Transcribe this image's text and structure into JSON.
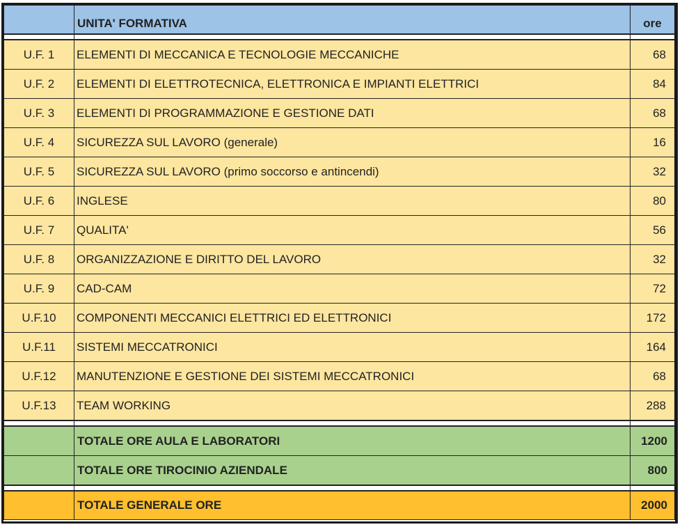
{
  "header": {
    "code": "",
    "unit_label": "UNITA' FORMATIVA",
    "hours_label": "ore"
  },
  "units": [
    {
      "code": "U.F. 1",
      "name": "ELEMENTI DI MECCANICA E TECNOLOGIE MECCANICHE",
      "hours": "68"
    },
    {
      "code": "U.F. 2",
      "name": "ELEMENTI DI ELETTROTECNICA,  ELETTRONICA E IMPIANTI ELETTRICI",
      "hours": "84"
    },
    {
      "code": "U.F. 3",
      "name": "ELEMENTI DI PROGRAMMAZIONE E GESTIONE DATI",
      "hours": "68"
    },
    {
      "code": "U.F. 4",
      "name": "SICUREZZA SUL LAVORO (generale)",
      "hours": "16"
    },
    {
      "code": "U.F. 5",
      "name": "SICUREZZA SUL LAVORO (primo soccorso e antincendi)",
      "hours": "32"
    },
    {
      "code": "U.F. 6",
      "name": "INGLESE",
      "hours": "80"
    },
    {
      "code": "U.F. 7",
      "name": "QUALITA'",
      "hours": "56"
    },
    {
      "code": "U.F. 8",
      "name": "ORGANIZZAZIONE E DIRITTO DEL LAVORO",
      "hours": "32"
    },
    {
      "code": "U.F. 9",
      "name": "CAD-CAM",
      "hours": "72"
    },
    {
      "code": "U.F.10",
      "name": "COMPONENTI MECCANICI ELETTRICI ED ELETTRONICI",
      "hours": "172"
    },
    {
      "code": "U.F.11",
      "name": "SISTEMI MECCATRONICI",
      "hours": "164"
    },
    {
      "code": "U.F.12",
      "name": "MANUTENZIONE E GESTIONE DEI SISTEMI MECCATRONICI",
      "hours": "68"
    },
    {
      "code": "U.F.13",
      "name": "TEAM WORKING",
      "hours": "288"
    }
  ],
  "totals": [
    {
      "label": "TOTALE ORE AULA E LABORATORI",
      "hours": "1200"
    },
    {
      "label": "TOTALE ORE TIROCINIO AZIENDALE",
      "hours": "800"
    }
  ],
  "grand_total": {
    "label": "TOTALE GENERALE ORE",
    "hours": "2000"
  },
  "colors": {
    "header": "#9dc3e6",
    "unit_row": "#fde6a0",
    "subtotal_row": "#a9d18e",
    "grand_total_row": "#ffbf2e"
  }
}
